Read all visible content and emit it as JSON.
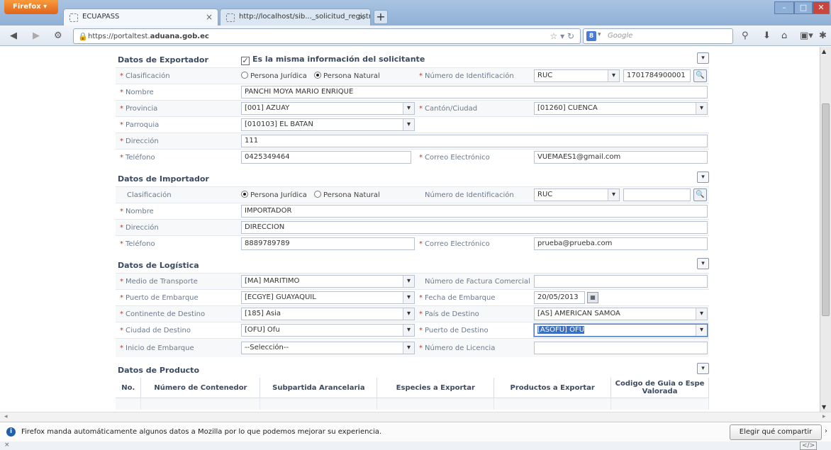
{
  "browser": {
    "menu_label": "Firefox",
    "tabs": [
      {
        "title": "ECUAPASS"
      },
      {
        "title": "http://localhost/sib..._solicitud_registro"
      }
    ],
    "new_tab": "+",
    "url_prefix": "https://portaltest.",
    "url_domain": "aduana.gob.ec",
    "search_engine_badge": "8",
    "search_placeholder": "Google",
    "nav_icons": [
      "back-icon",
      "forward-icon",
      "identity-icon",
      "star-icon",
      "reload-icon",
      "download-icon",
      "home-icon",
      "bookmarks-icon",
      "addon-icon"
    ]
  },
  "notification": {
    "text": "Firefox manda automáticamente algunos datos a Mozilla por lo que podemos mejorar su experiencia.",
    "button": "Elegir qué compartir"
  },
  "required_mark": "*",
  "exportador": {
    "title": "Datos de Exportador",
    "same_info_label": "Es la misma información del solicitante",
    "same_info_checked": true,
    "clasificacion_label": "Clasificación",
    "opt_juridica": "Persona Jurídica",
    "opt_natural": "Persona Natural",
    "selected": "Persona Natural",
    "num_id_label": "Número de Identificación",
    "tipo_id": "RUC",
    "num_id": "1701784900001",
    "nombre_label": "Nombre",
    "nombre": "PANCHI MOYA MARIO ENRIQUE",
    "provincia_label": "Provincia",
    "provincia": "[001] AZUAY",
    "canton_label": "Cantón/Ciudad",
    "canton": "[01260] CUENCA",
    "parroquia_label": "Parroquia",
    "parroquia": "[010103] EL BATAN",
    "direccion_label": "Dirección",
    "direccion": "111",
    "telefono_label": "Teléfono",
    "telefono": "0425349464",
    "correo_label": "Correo Electrónico",
    "correo": "VUEMAES1@gmail.com"
  },
  "importador": {
    "title": "Datos de Importador",
    "clasificacion_label": "Clasificación",
    "opt_juridica": "Persona Jurídica",
    "opt_natural": "Persona Natural",
    "selected": "Persona Jurídica",
    "num_id_label": "Número de Identificación",
    "tipo_id": "RUC",
    "num_id": "",
    "nombre_label": "Nombre",
    "nombre": "IMPORTADOR",
    "direccion_label": "Dirección",
    "direccion": "DIRECCION",
    "telefono_label": "Teléfono",
    "telefono": "8889789789",
    "correo_label": "Correo Electrónico",
    "correo": "prueba@prueba.com"
  },
  "logistica": {
    "title": "Datos de Logística",
    "medio_label": "Medio de Transporte",
    "medio": "[MA] MARITIMO",
    "factura_label": "Número de Factura Comercial",
    "factura": "",
    "puerto_emb_label": "Puerto de Embarque",
    "puerto_emb": "[ECGYE] GUAYAQUIL",
    "fecha_label": "Fecha de Embarque",
    "fecha": "20/05/2013",
    "continente_label": "Continente de Destino",
    "continente": "[185] Asia",
    "pais_label": "País de Destino",
    "pais": "[AS] AMERICAN SAMOA",
    "ciudad_label": "Ciudad de Destino",
    "ciudad": "[OFU] Ofu",
    "puerto_dest_label": "Puerto de Destino",
    "puerto_dest": "[ASOFU] OFU",
    "inicio_label": "Inicio de Embarque",
    "inicio": "--Selección--",
    "licencia_label": "Número de Licencia",
    "licencia": ""
  },
  "producto": {
    "title": "Datos de Producto",
    "columns": [
      "No.",
      "Número de Contenedor",
      "Subpartida Arancelaria",
      "Especies a Exportar",
      "Productos a Exportar",
      "Codigo de Guia o Espe Valorada"
    ]
  }
}
